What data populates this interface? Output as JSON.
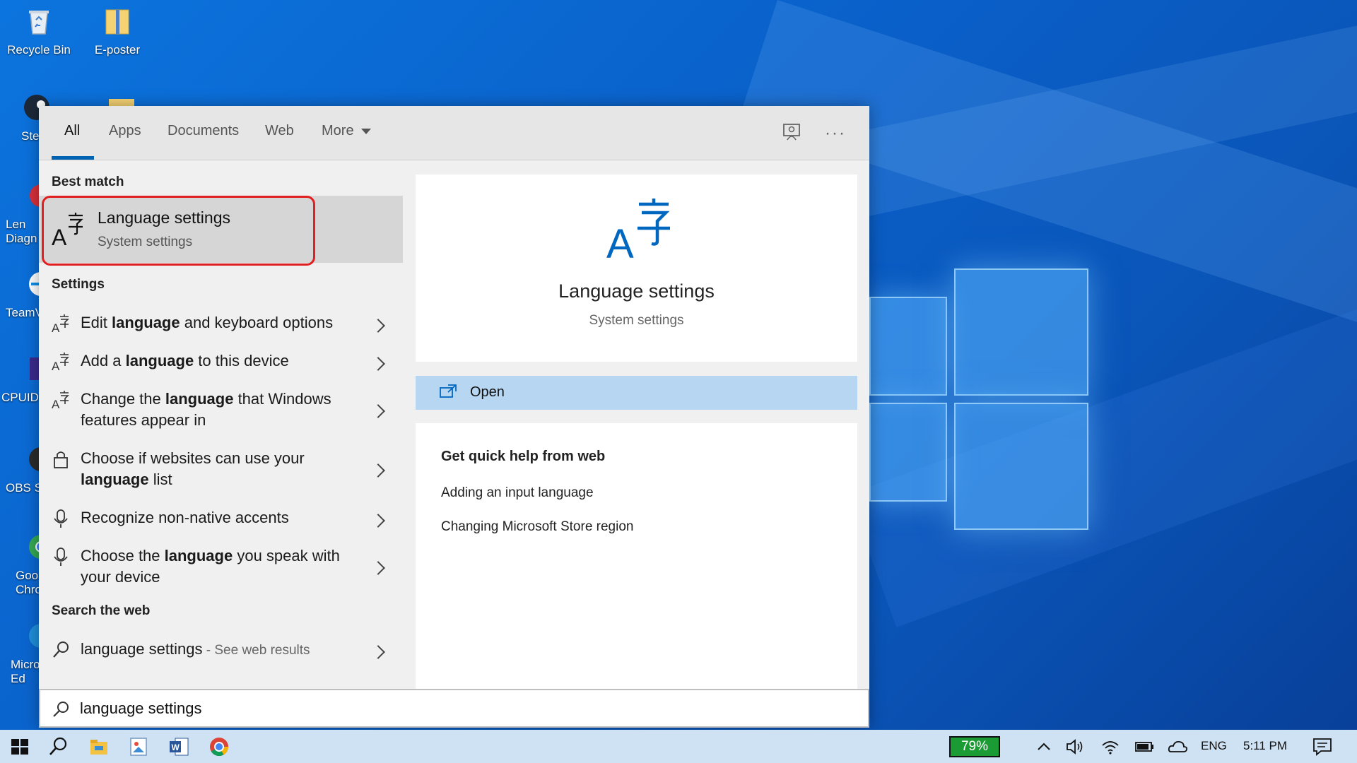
{
  "desktop": {
    "icons": [
      {
        "label": "Recycle Bin"
      },
      {
        "label": "E-poster"
      },
      {
        "label": "Ste"
      },
      {
        "label": "Len Diagn"
      },
      {
        "label": "TeamV"
      },
      {
        "label": "CPUID"
      },
      {
        "label": "OBS S"
      },
      {
        "label": "Goo Chro"
      },
      {
        "label": "Micro Ed"
      }
    ]
  },
  "search": {
    "tabs": [
      {
        "label": "All",
        "active": true
      },
      {
        "label": "Apps"
      },
      {
        "label": "Documents"
      },
      {
        "label": "Web"
      },
      {
        "label": "More"
      }
    ],
    "toolbar": {
      "feedback_icon": "feedback-icon",
      "more_icon": "ellipsis-icon",
      "ellipsis": "···"
    },
    "best_match_label": "Best match",
    "best_match": {
      "title": "Language settings",
      "subtitle": "System settings"
    },
    "settings_label": "Settings",
    "settings_items": [
      {
        "pre": "Edit ",
        "bold": "language",
        "post": " and keyboard options",
        "icon": "language-icon"
      },
      {
        "pre": "Add a ",
        "bold": "language",
        "post": " to this device",
        "icon": "language-icon"
      },
      {
        "pre": "Change the ",
        "bold": "language",
        "post": " that Windows features appear in",
        "icon": "language-icon"
      },
      {
        "pre": "Choose if websites can use your ",
        "bold": "language",
        "post": " list",
        "icon": "lock-icon"
      },
      {
        "pre": "Recognize non-native accents",
        "bold": "",
        "post": "",
        "icon": "microphone-icon"
      },
      {
        "pre": "Choose the ",
        "bold": "language",
        "post": " you speak with your device",
        "icon": "microphone-icon"
      }
    ],
    "web_label": "Search the web",
    "web_item": {
      "query": "language settings",
      "suffix": " - See web results"
    },
    "detail": {
      "title": "Language settings",
      "subtitle": "System settings",
      "open_label": "Open",
      "help_heading": "Get quick help from web",
      "help_links": [
        "Adding an input language",
        "Changing Microsoft Store region"
      ]
    },
    "query": "language settings"
  },
  "taskbar": {
    "battery_percent": "79%",
    "language": "ENG",
    "time": "5:11 PM"
  }
}
